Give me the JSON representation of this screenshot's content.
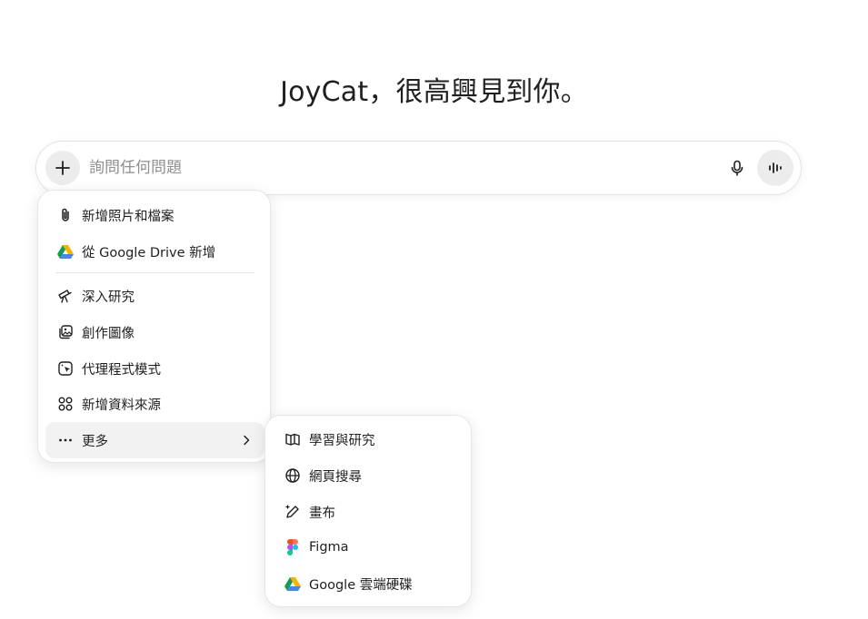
{
  "greeting": "JoyCat，很高興見到你。",
  "composer": {
    "placeholder": "詢問任何問題",
    "plus_icon": "plus-icon",
    "mic_icon": "microphone-icon",
    "voice_icon": "voice-mode-icon"
  },
  "attach_menu": {
    "items": [
      {
        "label": "新增照片和檔案",
        "icon": "paperclip-icon"
      },
      {
        "label": "從 Google Drive 新增",
        "icon": "google-drive-icon"
      },
      {
        "label": "深入研究",
        "icon": "telescope-icon"
      },
      {
        "label": "創作圖像",
        "icon": "image-create-icon"
      },
      {
        "label": "代理程式模式",
        "icon": "agent-cursor-icon"
      },
      {
        "label": "新增資料來源",
        "icon": "apps-icon"
      },
      {
        "label": "更多",
        "icon": "more-dots-icon"
      }
    ]
  },
  "more_menu": {
    "items": [
      {
        "label": "學習與研究",
        "icon": "book-open-icon"
      },
      {
        "label": "網頁搜尋",
        "icon": "globe-icon"
      },
      {
        "label": "畫布",
        "icon": "pen-sparkle-icon"
      },
      {
        "label": "Figma",
        "icon": "figma-icon"
      },
      {
        "label": "Google 雲端硬碟",
        "icon": "google-drive-icon"
      }
    ]
  },
  "colors": {
    "drive_green": "#0F9D58",
    "drive_yellow": "#F4B400",
    "drive_blue": "#4285F4",
    "figma_red": "#F24E1E",
    "figma_orange": "#FF7262",
    "figma_purple": "#A259FF",
    "figma_blue": "#1ABCFE",
    "figma_green": "#0ACF83"
  }
}
